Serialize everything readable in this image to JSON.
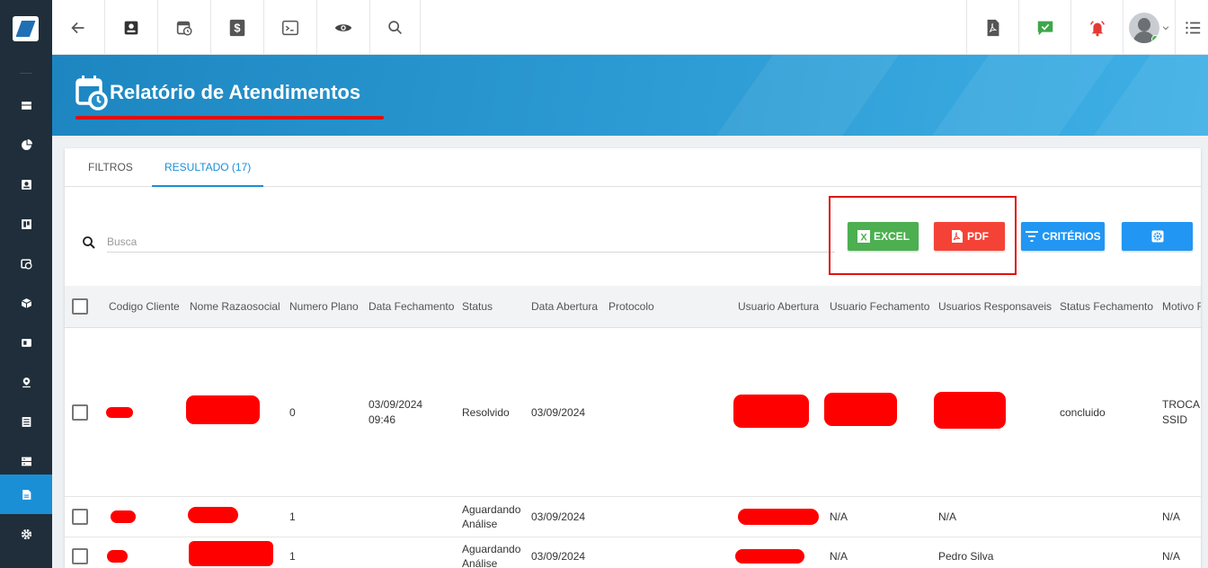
{
  "page": {
    "title": "Relatório de Atendimentos"
  },
  "tabs": [
    {
      "label": "FILTROS",
      "active": false
    },
    {
      "label": "RESULTADO (17)",
      "active": true
    }
  ],
  "search": {
    "placeholder": "Busca",
    "value": ""
  },
  "actions": {
    "excel": "EXCEL",
    "pdf": "PDF",
    "criterios": "CRITÉRIOS"
  },
  "colors": {
    "sidebar": "#1f2e3a",
    "accent": "#1a8fd6",
    "excel": "#4caf50",
    "pdf": "#f44336",
    "criterios": "#2196f3",
    "highlight": "#e01010"
  },
  "sidebar_icons": [
    "dashboard-icon",
    "pie-chart-icon",
    "contact-card-icon",
    "kanban-icon",
    "calendar-clock-icon",
    "package-icon",
    "id-card-icon",
    "map-pin-icon",
    "document-list-icon",
    "server-icon",
    "report-icon",
    "settings-icon"
  ],
  "sidebar_active": "report-icon",
  "toolbar_icons": [
    "back-arrow-icon",
    "contact-card-icon",
    "calendar-clock-icon",
    "dollar-icon",
    "terminal-icon",
    "eye-icon",
    "search-icon",
    "pdf-file-icon",
    "chat-check-icon",
    "bell-alarm-icon",
    "user-avatar",
    "list-menu-icon"
  ],
  "table": {
    "columns": [
      "Codigo Cliente",
      "Nome Razaosocial",
      "Numero Plano",
      "Data Fechamento",
      "Status",
      "Data Abertura",
      "Protocolo",
      "Usuario Abertura",
      "Usuario Fechamento",
      "Usuarios Responsaveis",
      "Status Fechamento",
      "Motivo F"
    ],
    "rows": [
      {
        "numero_plano": "0",
        "data_fechamento_1": "03/09/2024",
        "data_fechamento_2": "09:46",
        "status_1": "Resolvido",
        "status_2": "",
        "data_abertura": "03/09/2024",
        "protocolo": "",
        "usuario_fechamento": "",
        "usuarios_responsaveis": "",
        "status_fechamento": "concluido",
        "motivo_1": "TROCA I",
        "motivo_2": "SSID"
      },
      {
        "numero_plano": "1",
        "data_fechamento_1": "",
        "data_fechamento_2": "",
        "status_1": "Aguardando",
        "status_2": "Análise",
        "data_abertura": "03/09/2024",
        "protocolo": "",
        "usuario_fechamento": "N/A",
        "usuarios_responsaveis": "N/A",
        "status_fechamento": "",
        "motivo_1": "N/A",
        "motivo_2": ""
      },
      {
        "numero_plano": "1",
        "data_fechamento_1": "",
        "data_fechamento_2": "",
        "status_1": "Aguardando",
        "status_2": "Análise",
        "data_abertura": "03/09/2024",
        "protocolo": "",
        "usuario_fechamento": "N/A",
        "usuarios_responsaveis": "Pedro Silva",
        "status_fechamento": "",
        "motivo_1": "N/A",
        "motivo_2": ""
      }
    ]
  }
}
